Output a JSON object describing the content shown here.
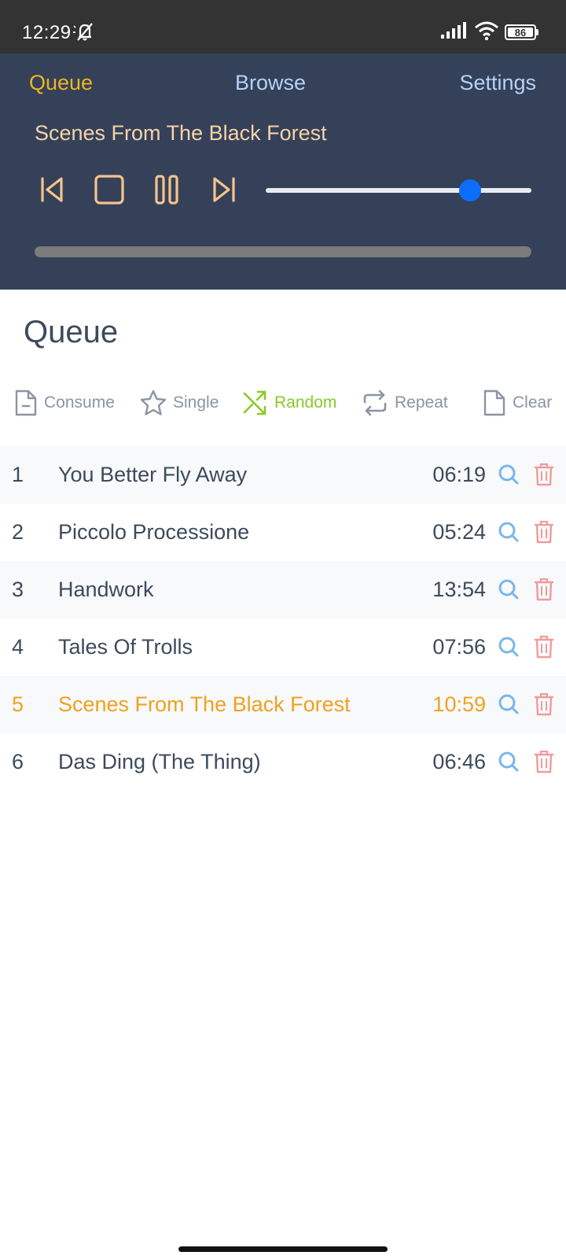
{
  "status_bar": {
    "time": "12:29",
    "battery": "86",
    "icons": [
      "bell-off-icon",
      "signal-icon",
      "wifi-icon",
      "battery-icon"
    ]
  },
  "nav": {
    "queue": "Queue",
    "browse": "Browse",
    "settings": "Settings"
  },
  "player": {
    "now_playing": "Scenes From The Black Forest",
    "controls": [
      "previous-icon",
      "stop-icon",
      "pause-icon",
      "next-icon"
    ],
    "volume_fraction": 0.77,
    "progress_fraction": 0.0
  },
  "queue": {
    "title": "Queue",
    "toolbar": {
      "consume": "Consume",
      "single": "Single",
      "random": "Random",
      "repeat": "Repeat",
      "clear": "Clear"
    },
    "items": [
      {
        "num": "1",
        "title": "You Better Fly Away",
        "duration": "06:19"
      },
      {
        "num": "2",
        "title": "Piccolo Processione",
        "duration": "05:24"
      },
      {
        "num": "3",
        "title": "Handwork",
        "duration": "13:54"
      },
      {
        "num": "4",
        "title": "Tales Of Trolls",
        "duration": "07:56"
      },
      {
        "num": "5",
        "title": "Scenes From The Black Forest",
        "duration": "10:59"
      },
      {
        "num": "6",
        "title": "Das Ding (The Thing)",
        "duration": "06:46"
      }
    ],
    "current_index": 4
  },
  "colors": {
    "header_bg": "#344158",
    "active_tab": "#f0b323",
    "inactive_tab": "#b5d2f5",
    "now_playing": "#f6d3a8",
    "control_icons": "#f6c38c",
    "volume_knob": "#0d6efd",
    "random_active": "#8ac926",
    "current_track": "#f0a11f",
    "search_icon": "#7ab6ea",
    "trash_icon": "#f19a9a",
    "text": "#3d4a5c"
  }
}
